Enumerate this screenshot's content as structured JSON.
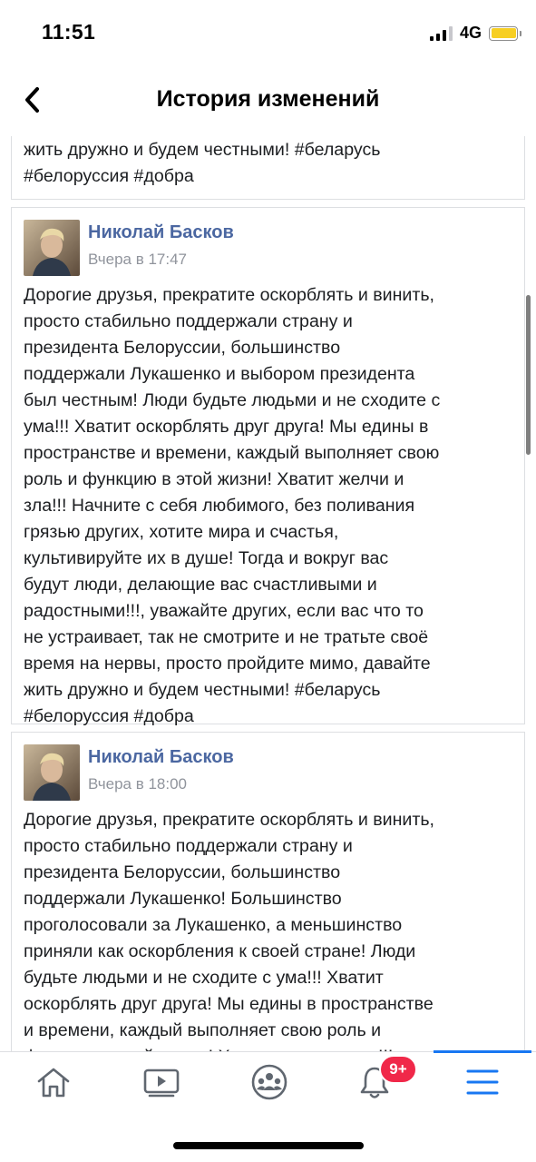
{
  "status_bar": {
    "time": "11:51",
    "network": "4G"
  },
  "header": {
    "title": "История изменений"
  },
  "revisions": [
    {
      "text_lines": [
        "жить дружно и будем честными! #беларусь",
        "#белоруссия #добра"
      ]
    },
    {
      "author": "Николай Басков",
      "timestamp": "Вчера в 17:47",
      "text_lines": [
        "Дорогие друзья, прекратите оскорблять и винить,",
        "просто стабильно поддержали страну и",
        "президента Белоруссии, большинство",
        "поддержали Лукашенко и выбором президента",
        "был честным! Люди будьте людьми и не сходите с",
        "ума!!! Хватит оскорблять друг друга! Мы едины в",
        "пространстве и времени, каждый выполняет свою",
        "роль и функцию в этой жизни! Хватит желчи и",
        "зла!!! Начните с себя любимого, без поливания",
        "грязью других, хотите мира и счастья,",
        "культивируйте их в душе! Тогда и вокруг вас",
        "будут люди, делающие вас счастливыми и",
        "радостными!!!, уважайте других, если вас что то",
        "не устраивает, так не смотрите и не тратьте своё",
        "время на нервы, просто пройдите мимо, давайте",
        "жить дружно и будем честными! #беларусь",
        "#белоруссия #добра"
      ]
    },
    {
      "author": "Николай Басков",
      "timestamp": "Вчера в 18:00",
      "text_lines": [
        "Дорогие друзья, прекратите оскорблять и винить,",
        "просто стабильно поддержали страну и",
        "президента Белоруссии, большинство",
        "поддержали Лукашенко! Большинство",
        "проголосовали за Лукашенко, а меньшинство",
        "приняли как оскорбления к своей стране! Люди",
        "будьте людьми и не сходите с ума!!! Хватит",
        "оскорблять друг друга! Мы едины в пространстве",
        "и времени, каждый выполняет свою роль и",
        "функцию в этой жизни! Хватит желчи и зла!!!"
      ]
    }
  ],
  "tab_bar": {
    "tabs": [
      {
        "name": "home",
        "icon": "home-icon"
      },
      {
        "name": "watch",
        "icon": "video-icon"
      },
      {
        "name": "groups",
        "icon": "groups-icon"
      },
      {
        "name": "notifications",
        "icon": "bell-icon"
      },
      {
        "name": "menu",
        "icon": "menu-icon",
        "active": true
      }
    ],
    "notification_badge": "9+"
  },
  "colors": {
    "accent": "#1877f2",
    "author": "#4b67a1",
    "badge": "#f02849",
    "icon": "#606770"
  }
}
